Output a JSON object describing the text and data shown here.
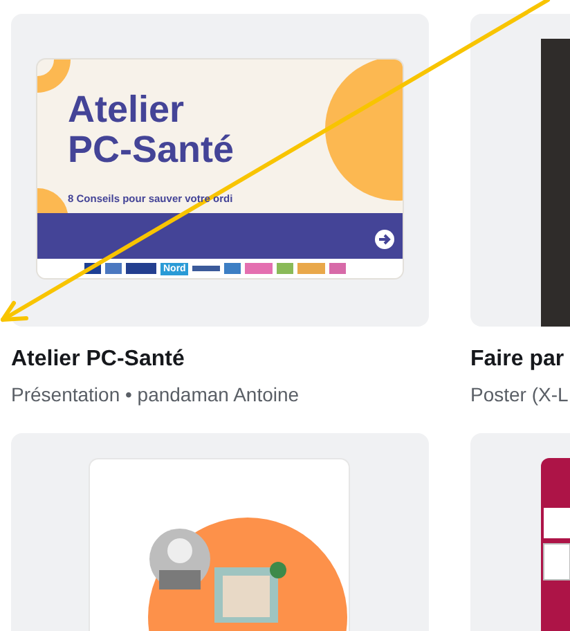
{
  "designs": [
    {
      "kind": "slide",
      "title": "Atelier PC-Santé",
      "meta": "Présentation • pandaman Antoine",
      "slide": {
        "heading": [
          "Atelier",
          "PC-Santé"
        ],
        "subtitle": "8  Conseils pour sauver votre ordi",
        "logo": "Nord"
      }
    },
    {
      "title": "Faire par",
      "meta": "Poster (X-L"
    },
    {
      "kind": "collage"
    },
    {
      "kind": "poster"
    }
  ]
}
